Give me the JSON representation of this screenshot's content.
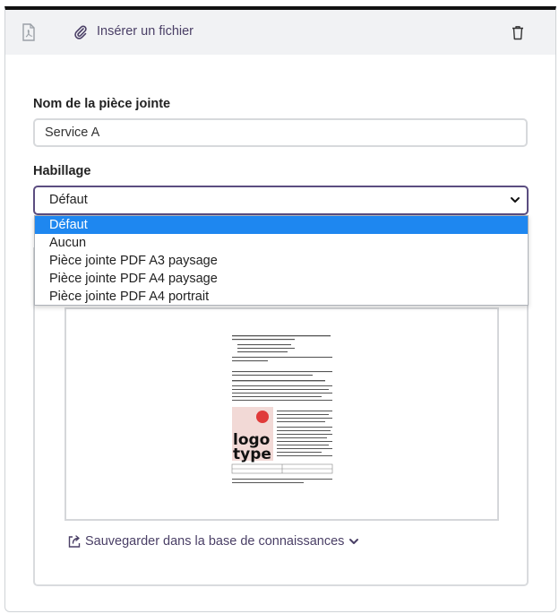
{
  "toolbar": {
    "insert_file_label": "Insérer un fichier",
    "icons": [
      "pdf-file-icon",
      "paperclip-icon",
      "trash-icon"
    ]
  },
  "form": {
    "name_label": "Nom de la pièce jointe",
    "name_value": "Service A",
    "habillage_label": "Habillage",
    "habillage_selected": "Défaut",
    "habillage_options": [
      "Défaut",
      "Aucun",
      "Pièce jointe PDF A3 paysage",
      "Pièce jointe PDF A4 paysage",
      "Pièce jointe PDF A4 portrait"
    ]
  },
  "preview": {
    "logo_text_line1": "logo",
    "logo_text_line2": "type"
  },
  "save_link_label": "Sauvegarder dans la base de connaissances",
  "colors": {
    "accent": "#5b4d80",
    "selected_option": "#1e87f0",
    "link": "#4a3f66",
    "toolbar_bg": "#f1f2f4",
    "logo_dot": "#e03a3a"
  }
}
